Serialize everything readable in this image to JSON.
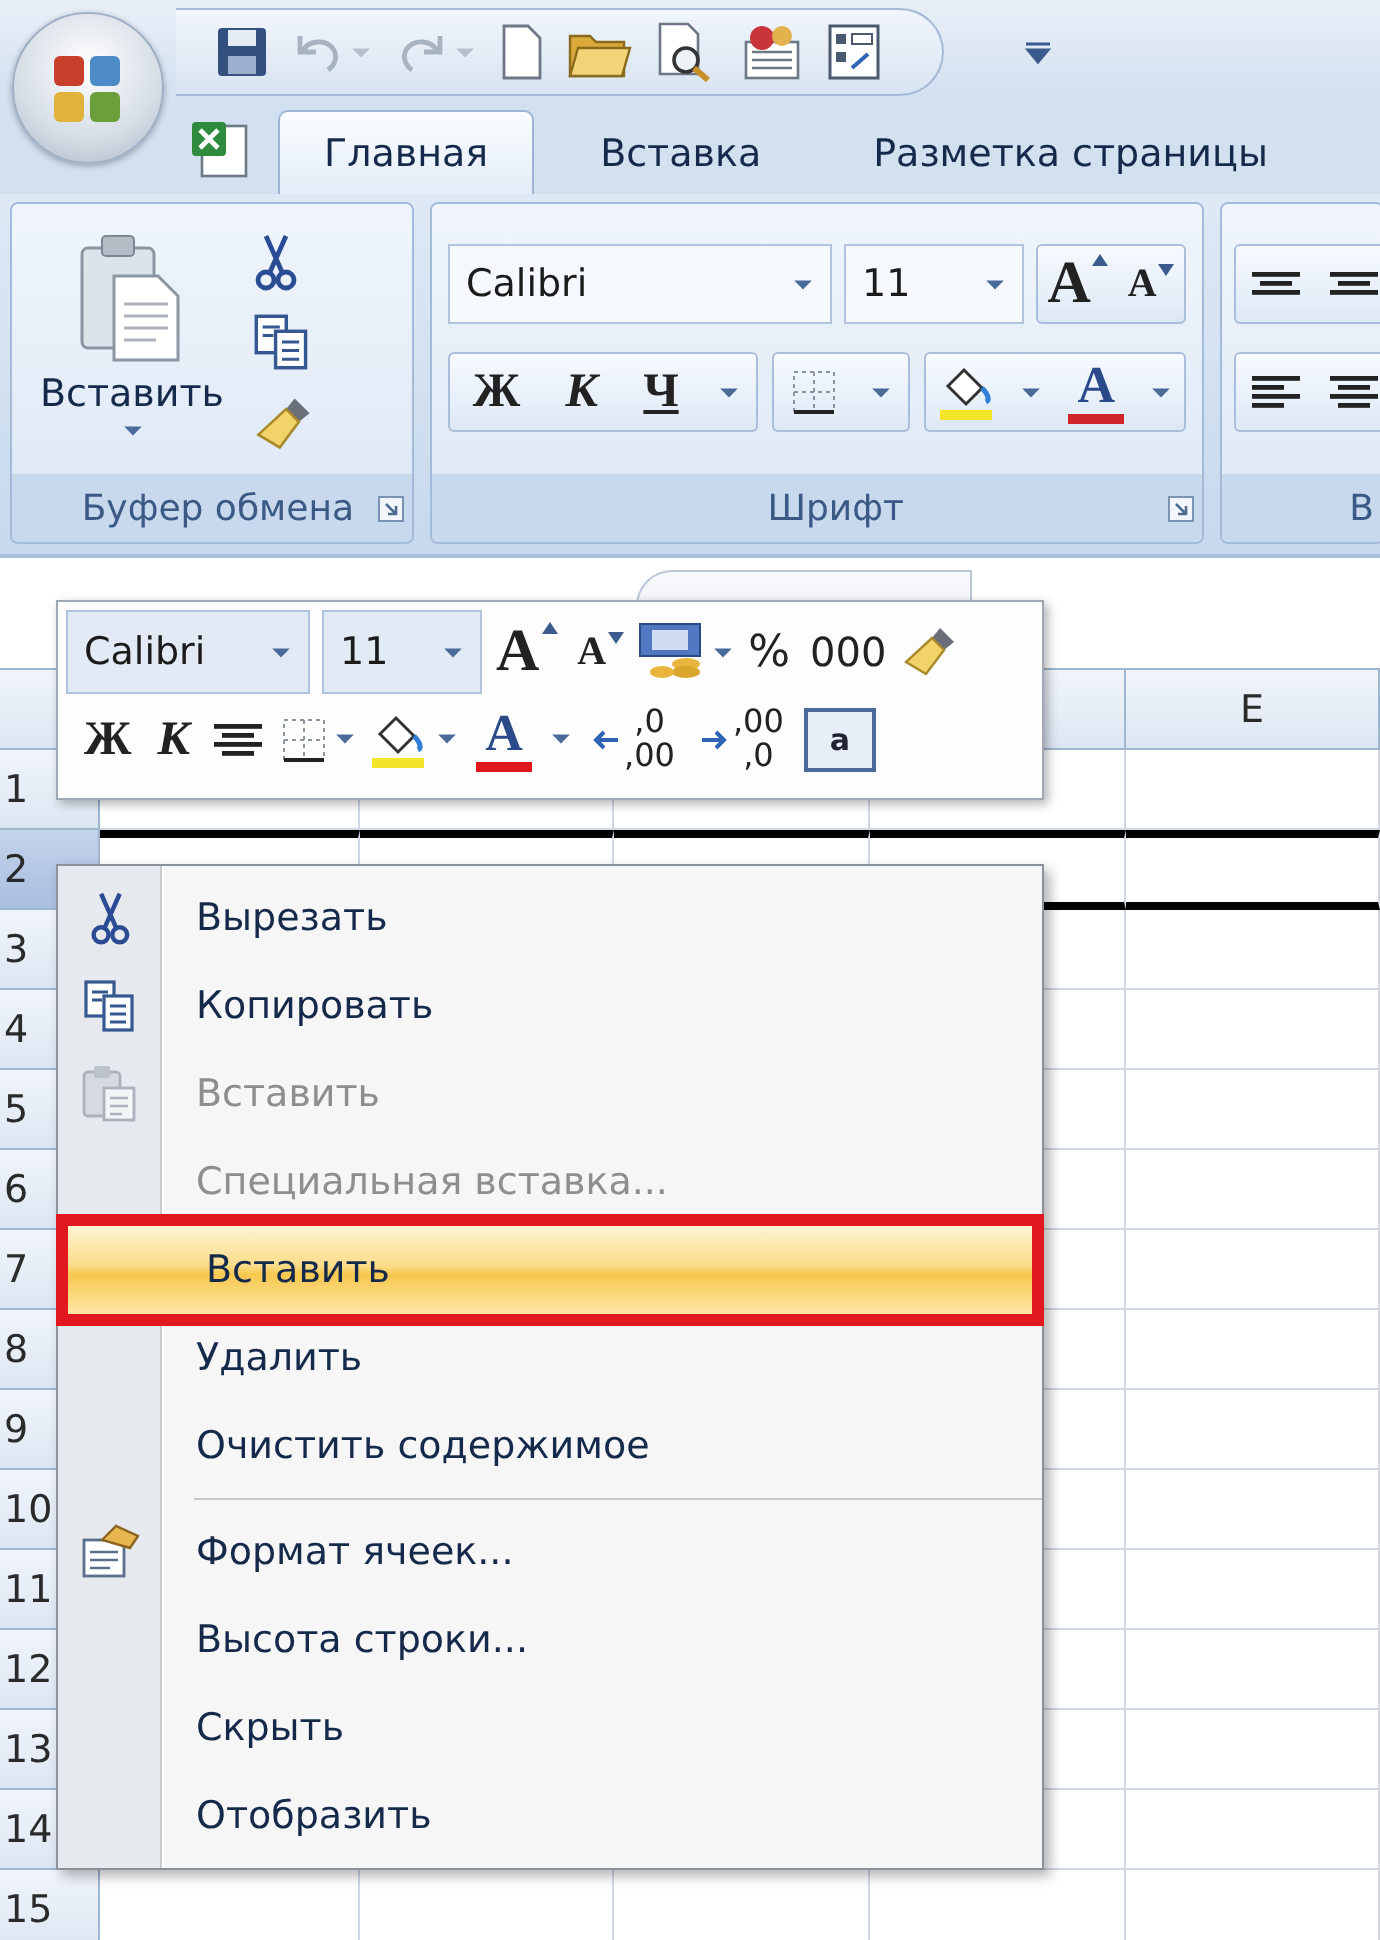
{
  "tabs": [
    {
      "label": "Главная",
      "selected": true
    },
    {
      "label": "Вставка",
      "selected": false
    },
    {
      "label": "Разметка страницы",
      "selected": false
    }
  ],
  "ribbon": {
    "clipboard": {
      "paste_label": "Вставить",
      "title": "Буфер обмена"
    },
    "font": {
      "font_name": "Calibri",
      "font_size": "11",
      "grow_label": "A",
      "shrink_label": "A",
      "bold_label": "Ж",
      "italic_label": "К",
      "underline_label": "Ч",
      "font_color_label": "A",
      "title": "Шрифт"
    },
    "next_group_title": "В"
  },
  "mini_toolbar": {
    "font_name": "Calibri",
    "font_size": "11",
    "grow_label": "A",
    "shrink_label": "A",
    "percent_label": "%",
    "thousands_label": "000",
    "bold_label": "Ж",
    "italic_label": "К",
    "font_color_label": "A",
    "increase_decimal": {
      "top": ",0",
      "bottom": ",00"
    },
    "decrease_decimal": {
      "top": ",00",
      "bottom": ",0"
    },
    "merge_label": "a"
  },
  "sheet": {
    "columns": [
      {
        "label": "E"
      }
    ],
    "rows": [
      {
        "label": "1",
        "selected": false
      },
      {
        "label": "2",
        "selected": true
      },
      {
        "label": "3",
        "selected": false
      },
      {
        "label": "4",
        "selected": false
      },
      {
        "label": "5",
        "selected": false
      },
      {
        "label": "6",
        "selected": false
      },
      {
        "label": "7",
        "selected": false
      },
      {
        "label": "8",
        "selected": false
      },
      {
        "label": "9",
        "selected": false
      },
      {
        "label": "10",
        "selected": false
      },
      {
        "label": "11",
        "selected": false
      },
      {
        "label": "12",
        "selected": false
      },
      {
        "label": "13",
        "selected": false
      },
      {
        "label": "14",
        "selected": false
      },
      {
        "label": "15",
        "selected": false
      }
    ]
  },
  "context_menu": {
    "items": [
      {
        "label": "Вырезать",
        "kind": "cut",
        "disabled": false,
        "selected": false,
        "framed": false,
        "separator_before": false
      },
      {
        "label": "Копировать",
        "kind": "copy",
        "disabled": false,
        "selected": false,
        "framed": false,
        "separator_before": false
      },
      {
        "label": "Вставить",
        "kind": "paste",
        "disabled": true,
        "selected": false,
        "framed": false,
        "separator_before": false
      },
      {
        "label": "Специальная вставка...",
        "kind": "plain",
        "disabled": true,
        "selected": false,
        "framed": false,
        "separator_before": false
      },
      {
        "label": "Вставить",
        "kind": "plain",
        "disabled": false,
        "selected": true,
        "framed": true,
        "separator_before": false
      },
      {
        "label": "Удалить",
        "kind": "plain",
        "disabled": false,
        "selected": false,
        "framed": false,
        "separator_before": false
      },
      {
        "label": "Очистить содержимое",
        "kind": "plain",
        "disabled": false,
        "selected": false,
        "framed": false,
        "separator_before": false
      },
      {
        "label": "Формат ячеек...",
        "kind": "format",
        "disabled": false,
        "selected": false,
        "framed": false,
        "separator_before": true
      },
      {
        "label": "Высота строки...",
        "kind": "plain",
        "disabled": false,
        "selected": false,
        "framed": false,
        "separator_before": false
      },
      {
        "label": "Скрыть",
        "kind": "plain",
        "disabled": false,
        "selected": false,
        "framed": false,
        "separator_before": false
      },
      {
        "label": "Отобразить",
        "kind": "plain",
        "disabled": false,
        "selected": false,
        "framed": false,
        "separator_before": false
      }
    ]
  }
}
